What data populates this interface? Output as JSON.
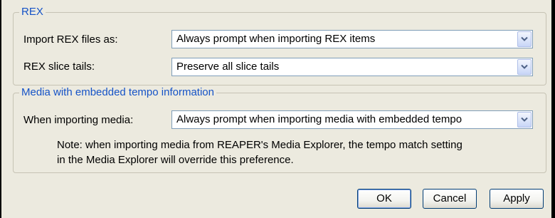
{
  "rex": {
    "legend": "REX",
    "import_label": "Import REX files as:",
    "import_value": "Always prompt when importing REX items",
    "tails_label": "REX slice tails:",
    "tails_value": "Preserve all slice tails"
  },
  "media": {
    "legend": "Media with embedded tempo information",
    "import_label": "When importing media:",
    "import_value": "Always prompt when importing media with embedded tempo",
    "note_line1": "Note: when importing media from REAPER's Media Explorer, the tempo match setting",
    "note_line2": "in the Media Explorer will override this preference."
  },
  "buttons": {
    "ok": "OK",
    "cancel": "Cancel",
    "apply": "Apply"
  },
  "icons": {
    "dropdown": "chevron-down-icon"
  },
  "colors": {
    "legend": "#1553c7",
    "panel_bg": "#eceadf",
    "button_border": "#003c74"
  }
}
